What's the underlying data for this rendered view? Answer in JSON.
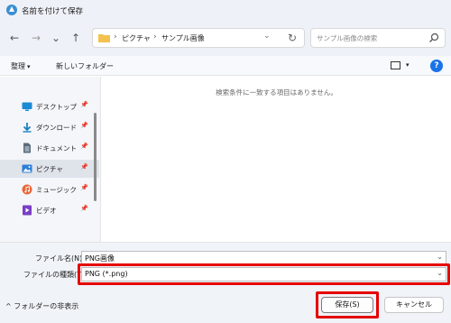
{
  "window": {
    "title": "名前を付けて保存"
  },
  "nav": {
    "back": "←",
    "forward": "→",
    "recent": "⌄",
    "up": "↑",
    "breadcrumbs": [
      "ピクチャ",
      "サンプル画像"
    ],
    "separator": "›",
    "dropdown": "⌄",
    "refresh": "↻",
    "search_placeholder": "サンプル画像の検索"
  },
  "commandbar": {
    "organize": "整理",
    "organize_caret": "▾",
    "new_folder": "新しいフォルダー",
    "view_caret": "▾",
    "help": "?"
  },
  "sidebar": {
    "items": [
      {
        "label": "デスクトップ",
        "icon": "desktop-icon",
        "color": "#1a8ad4"
      },
      {
        "label": "ダウンロード",
        "icon": "download-icon",
        "color": "#1a7fc1"
      },
      {
        "label": "ドキュメント",
        "icon": "documents-icon",
        "color": "#5a6b7d"
      },
      {
        "label": "ピクチャ",
        "icon": "pictures-icon",
        "color": "#2b7fd8",
        "selected": true
      },
      {
        "label": "ミュージック",
        "icon": "music-icon",
        "color": "#e8673a"
      },
      {
        "label": "ビデオ",
        "icon": "videos-icon",
        "color": "#7a3fc4"
      }
    ],
    "pin": "📌"
  },
  "content": {
    "empty_message": "検索条件に一致する項目はありません。"
  },
  "form": {
    "filename_label": "ファイル名(N):",
    "filename_value": "PNG画像",
    "filetype_label": "ファイルの種類(T):",
    "filetype_value": "PNG (*.png)",
    "caret": "⌄"
  },
  "footer": {
    "hide_folders": "フォルダーの非表示",
    "hide_caret": "^",
    "save": "保存(S)",
    "cancel": "キャンセル"
  },
  "colors": {
    "highlight": "#e60000",
    "accent": "#1a73e8"
  }
}
